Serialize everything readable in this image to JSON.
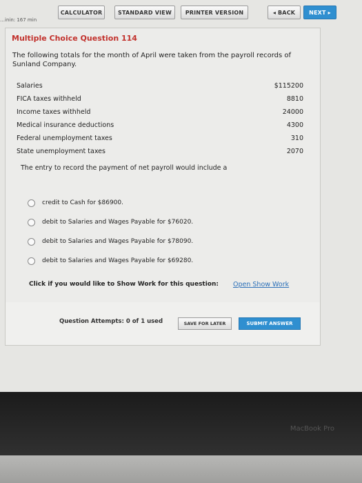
{
  "toolbar": {
    "calculator": "CALCULATOR",
    "standard_view": "STANDARD VIEW",
    "printer_version": "PRINTER VERSION",
    "back": "◂ BACK",
    "next": "NEXT ▸"
  },
  "timer_text": "…inin: 167 min",
  "question": {
    "title": "Multiple Choice Question 114",
    "intro": "The following totals for the month of April were taken from the payroll records of Sunland Company.",
    "items": [
      {
        "label": "Salaries",
        "amount": "$115200"
      },
      {
        "label": "FICA taxes withheld",
        "amount": "8810"
      },
      {
        "label": "Income taxes withheld",
        "amount": "24000"
      },
      {
        "label": "Medical insurance deductions",
        "amount": "4300"
      },
      {
        "label": "Federal unemployment taxes",
        "amount": "310"
      },
      {
        "label": "State unemployment taxes",
        "amount": "2070"
      }
    ],
    "prompt": "The entry to record the payment of net payroll would include a",
    "choices": [
      "credit to Cash for $86900.",
      "debit to Salaries and Wages Payable for $76020.",
      "debit to Salaries and Wages Payable for $78090.",
      "debit to Salaries and Wages Payable for $69280."
    ],
    "show_work_label": "Click if you would like to Show Work for this question:",
    "show_work_link": "Open Show Work"
  },
  "footer": {
    "attempts": "Question Attempts: 0 of 1 used",
    "save": "SAVE FOR LATER",
    "submit": "SUBMIT ANSWER"
  },
  "bezel_brand": "MacBook Pro"
}
